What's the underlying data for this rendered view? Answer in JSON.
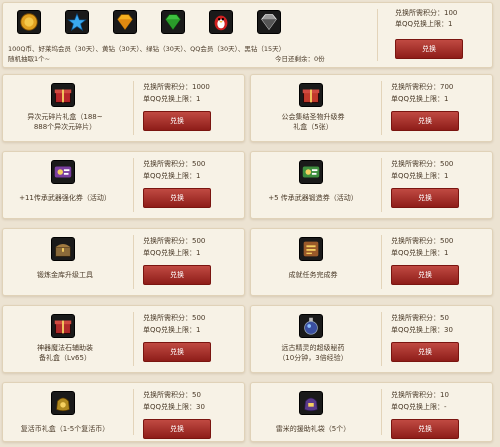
{
  "cost_label": "兑换所需积分：",
  "limit_label": "单QQ兑换上限：",
  "exchange_label": "兑换",
  "top": {
    "items_line": "100Q币、好莱坞会员（30天）、黄钻（30天）、绿钻（30天）、QQ会员（30天）、黑钻（15天）",
    "random_line": "随机抽取1个~",
    "today_prefix": "今日还剩余：",
    "today_value": "0份",
    "cost": "100",
    "limit": "1",
    "icons": [
      "gold-coin-icon",
      "blue-star-icon",
      "yellow-diamond-icon",
      "green-diamond-icon",
      "qq-penguin-icon",
      "black-diamond-icon"
    ]
  },
  "items": [
    {
      "name1": "异次元碎片礼盒（188~",
      "name2": "888个异次元碎片）",
      "cost": "1000",
      "limit": "1",
      "icon": "red-gift-box-icon",
      "color": "#b8262a"
    },
    {
      "name1": "公会集结圣物升级券",
      "name2": "礼盒（5张）",
      "cost": "700",
      "limit": "1",
      "icon": "red-gift-box-icon",
      "color": "#c0392b"
    },
    {
      "name1": "+11传承武器强化券（活动）",
      "name2": "",
      "cost": "500",
      "limit": "1",
      "icon": "purple-ticket-icon",
      "color": "#7b3fa0"
    },
    {
      "name1": "+5 传承武器锻造券（活动）",
      "name2": "",
      "cost": "500",
      "limit": "1",
      "icon": "green-ticket-icon",
      "color": "#3e8e3e"
    },
    {
      "name1": "锻炼金库升级工具",
      "name2": "",
      "cost": "500",
      "limit": "1",
      "icon": "treasure-chest-icon",
      "color": "#8a6a3a"
    },
    {
      "name1": "成就任务完成券",
      "name2": "",
      "cost": "500",
      "limit": "1",
      "icon": "quest-ticket-icon",
      "color": "#9a5a2a"
    },
    {
      "name1": "神器魔法石辅助装",
      "name2": "备礼盒（Lv65）",
      "cost": "500",
      "limit": "1",
      "icon": "red-gift-box-icon",
      "color": "#b02a2a"
    },
    {
      "name1": "远古精灵的超级秘药",
      "name2": "（10分钟，3倍经验）",
      "cost": "50",
      "limit": "30",
      "icon": "potion-icon",
      "color": "#3a4fa0"
    },
    {
      "name1": "复活币礼盒（1-5个复活币）",
      "name2": "",
      "cost": "50",
      "limit": "30",
      "icon": "gold-coin-bag-icon",
      "color": "#b08a20"
    },
    {
      "name1": "雷米的援助礼袋（5个）",
      "name2": "",
      "cost": "10",
      "limit": "-",
      "icon": "purple-bag-icon",
      "color": "#5a3a8a"
    }
  ]
}
